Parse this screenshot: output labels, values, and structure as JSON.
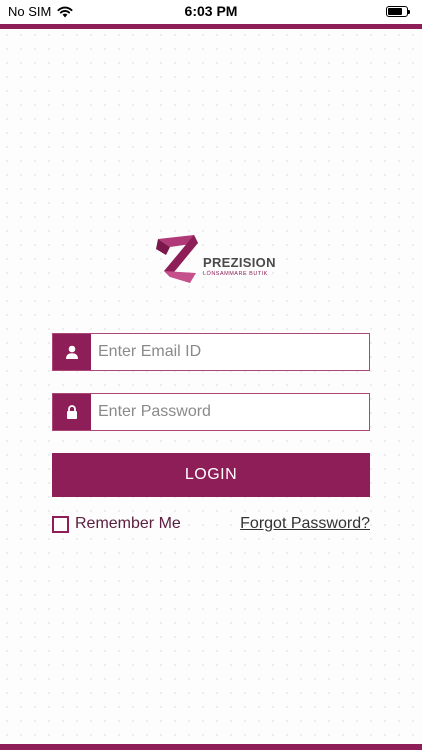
{
  "status_bar": {
    "carrier": "No SIM",
    "time": "6:03 PM",
    "wifi_icon": "wifi-icon",
    "battery_icon": "battery-icon"
  },
  "logo": {
    "name": "PREZISION",
    "tagline": "LÖNSAMMARE BUTIK"
  },
  "login_form": {
    "email_placeholder": "Enter Email ID",
    "email_value": "",
    "email_icon": "user-icon",
    "password_placeholder": "Enter Password",
    "password_value": "",
    "password_icon": "lock-icon",
    "login_label": "LOGIN",
    "remember_label": "Remember Me",
    "remember_checked": false,
    "forgot_label": "Forgot Password?"
  },
  "colors": {
    "brand": "#8e1e58",
    "border": "#a94777",
    "placeholder": "#8a8a8a",
    "background": "#fdfdfd"
  }
}
